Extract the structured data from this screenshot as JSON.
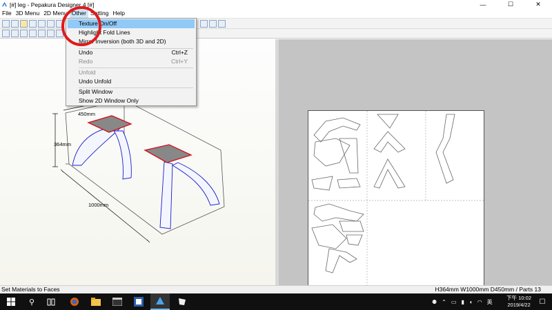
{
  "window": {
    "title": "[#] leg - Pepakura Designer 4 [#]",
    "minimize": "—",
    "maximize": "☐",
    "close": "✕"
  },
  "menubar": [
    "File",
    "3D Menu",
    "2D Menu",
    "Other",
    "Setting",
    "Help"
  ],
  "dropdown": {
    "items": [
      {
        "label": "Texture On/Off",
        "shortcut": ""
      },
      {
        "label": "Highlight Fold Lines",
        "shortcut": ""
      },
      {
        "label": "Mirror Inversion (both 3D and 2D)",
        "shortcut": ""
      },
      {
        "label": "Undo",
        "shortcut": "Ctrl+Z"
      },
      {
        "label": "Redo",
        "shortcut": "Ctrl+Y"
      },
      {
        "label": "Unfold",
        "shortcut": ""
      },
      {
        "label": "Undo Unfold",
        "shortcut": ""
      },
      {
        "label": "Split Window",
        "shortcut": ""
      },
      {
        "label": "Show 2D Window Only",
        "shortcut": ""
      }
    ]
  },
  "model3d": {
    "dim_width": "450mm",
    "dim_height": "364mm",
    "dim_length": "1000mm"
  },
  "status": {
    "left": "Set Materials to Faces",
    "right": "H364mm W1000mm D450mm / Parts 13"
  },
  "taskbar": {
    "time": "下午 10:02",
    "date": "2019/4/22",
    "ime": "英",
    "notif": "☐",
    "search": "⚲"
  },
  "colors": {
    "highlight": "#91c9f7",
    "annotation": "#e01a1a",
    "taskbar": "#101010",
    "edge_red": "#d0101a",
    "edge_blue": "#1a1acc"
  }
}
